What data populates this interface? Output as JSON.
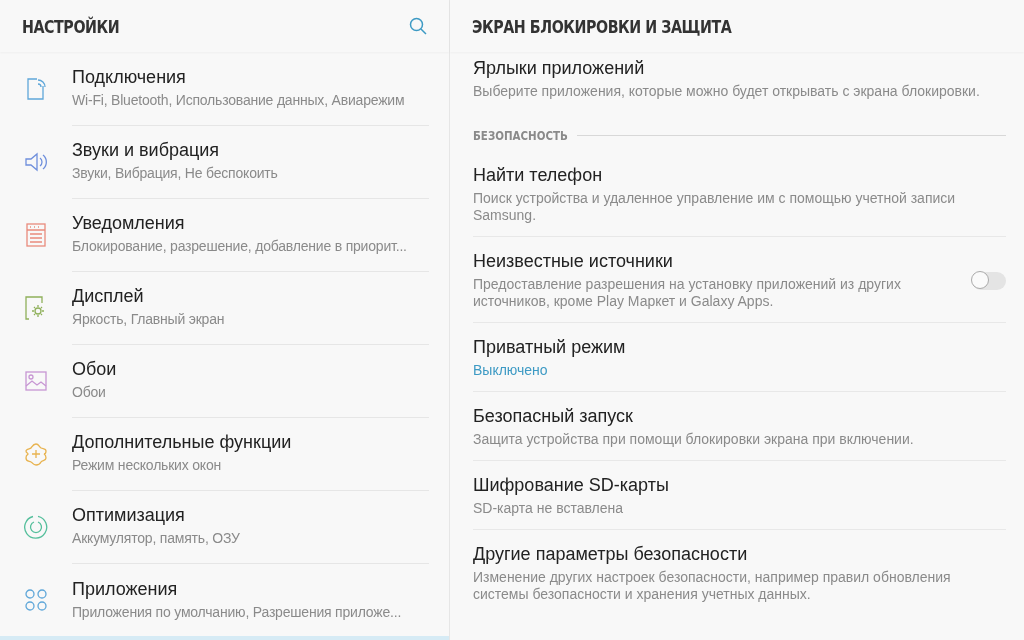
{
  "left_panel": {
    "title": "НАСТРОЙКИ",
    "items": [
      {
        "title": "Подключения",
        "subtitle": "Wi-Fi, Bluetooth, Использование данных, Авиарежим"
      },
      {
        "title": "Звуки и вибрация",
        "subtitle": "Звуки, Вибрация, Не беспокоить"
      },
      {
        "title": "Уведомления",
        "subtitle": "Блокирование, разрешение, добавление в приорит..."
      },
      {
        "title": "Дисплей",
        "subtitle": "Яркость, Главный экран"
      },
      {
        "title": "Обои",
        "subtitle": "Обои"
      },
      {
        "title": "Дополнительные функции",
        "subtitle": "Режим нескольких окон"
      },
      {
        "title": "Оптимизация",
        "subtitle": "Аккумулятор, память, ОЗУ"
      },
      {
        "title": "Приложения",
        "subtitle": "Приложения по умолчанию, Разрешения приложе..."
      }
    ]
  },
  "right_panel": {
    "title": "ЭКРАН БЛОКИРОВКИ И ЗАЩИТА",
    "rows": [
      {
        "kind": "setting",
        "title": "Ярлыки приложений",
        "subtitle": "Выберите приложения, которые можно будет открывать с экрана блокировки."
      },
      {
        "kind": "section",
        "title": "БЕЗОПАСНОСТЬ"
      },
      {
        "kind": "setting",
        "title": "Найти телефон",
        "subtitle": "Поиск устройства и удаленное управление им с помощью учетной записи Samsung."
      },
      {
        "kind": "toggle",
        "title": "Неизвестные источники",
        "subtitle": "Предоставление разрешения на установку приложений из других источников, кроме Play Маркет и Galaxy Apps.",
        "on": false
      },
      {
        "kind": "status",
        "title": "Приватный режим",
        "subtitle": "Выключено"
      },
      {
        "kind": "setting",
        "title": "Безопасный запуск",
        "subtitle": "Защита устройства при помощи блокировки экрана при включении."
      },
      {
        "kind": "setting",
        "title": "Шифрование SD-карты",
        "subtitle": "SD-карта не вставлена"
      },
      {
        "kind": "setting",
        "title": "Другие параметры безопасности",
        "subtitle": "Изменение других настроек безопасности, например правил обновления системы безопасности и хранения учетных данных."
      }
    ]
  }
}
